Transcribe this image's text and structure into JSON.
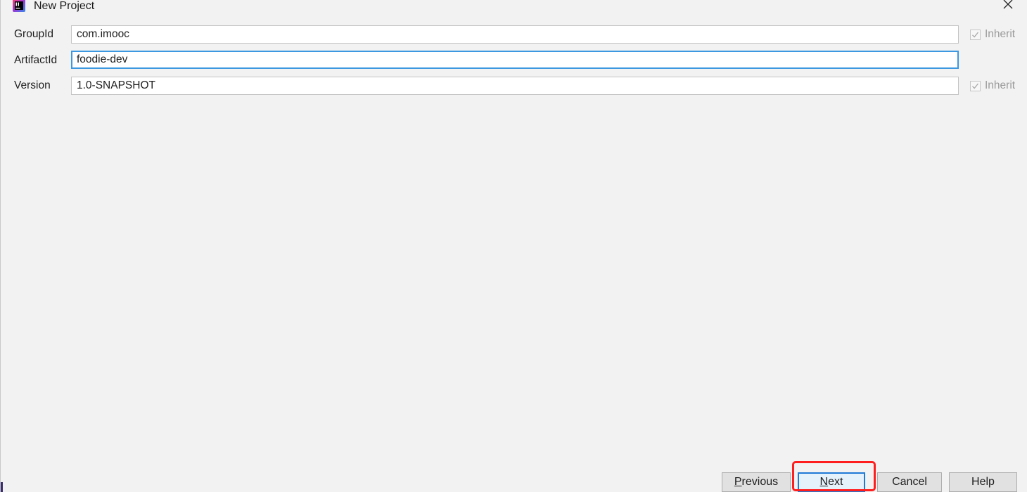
{
  "window": {
    "title": "New Project",
    "app_icon": "intellij-idea-icon",
    "close_icon": "close-icon",
    "close_glyph": "✕"
  },
  "form": {
    "rows": [
      {
        "label": "GroupId",
        "value": "com.imooc",
        "inherit": {
          "label": "Inherit",
          "checked": true
        }
      },
      {
        "label": "ArtifactId",
        "value": "foodie-dev"
      },
      {
        "label": "Version",
        "value": "1.0-SNAPSHOT",
        "inherit": {
          "label": "Inherit",
          "checked": true
        }
      }
    ]
  },
  "footer": {
    "previous": {
      "mnemonic": "P",
      "rest": "revious"
    },
    "next": {
      "mnemonic": "N",
      "rest": "ext"
    },
    "cancel": "Cancel",
    "help": "Help"
  },
  "colors": {
    "background": "#f2f2f2",
    "focus": "#3c98e0",
    "annotation": "#ff1e1e"
  }
}
